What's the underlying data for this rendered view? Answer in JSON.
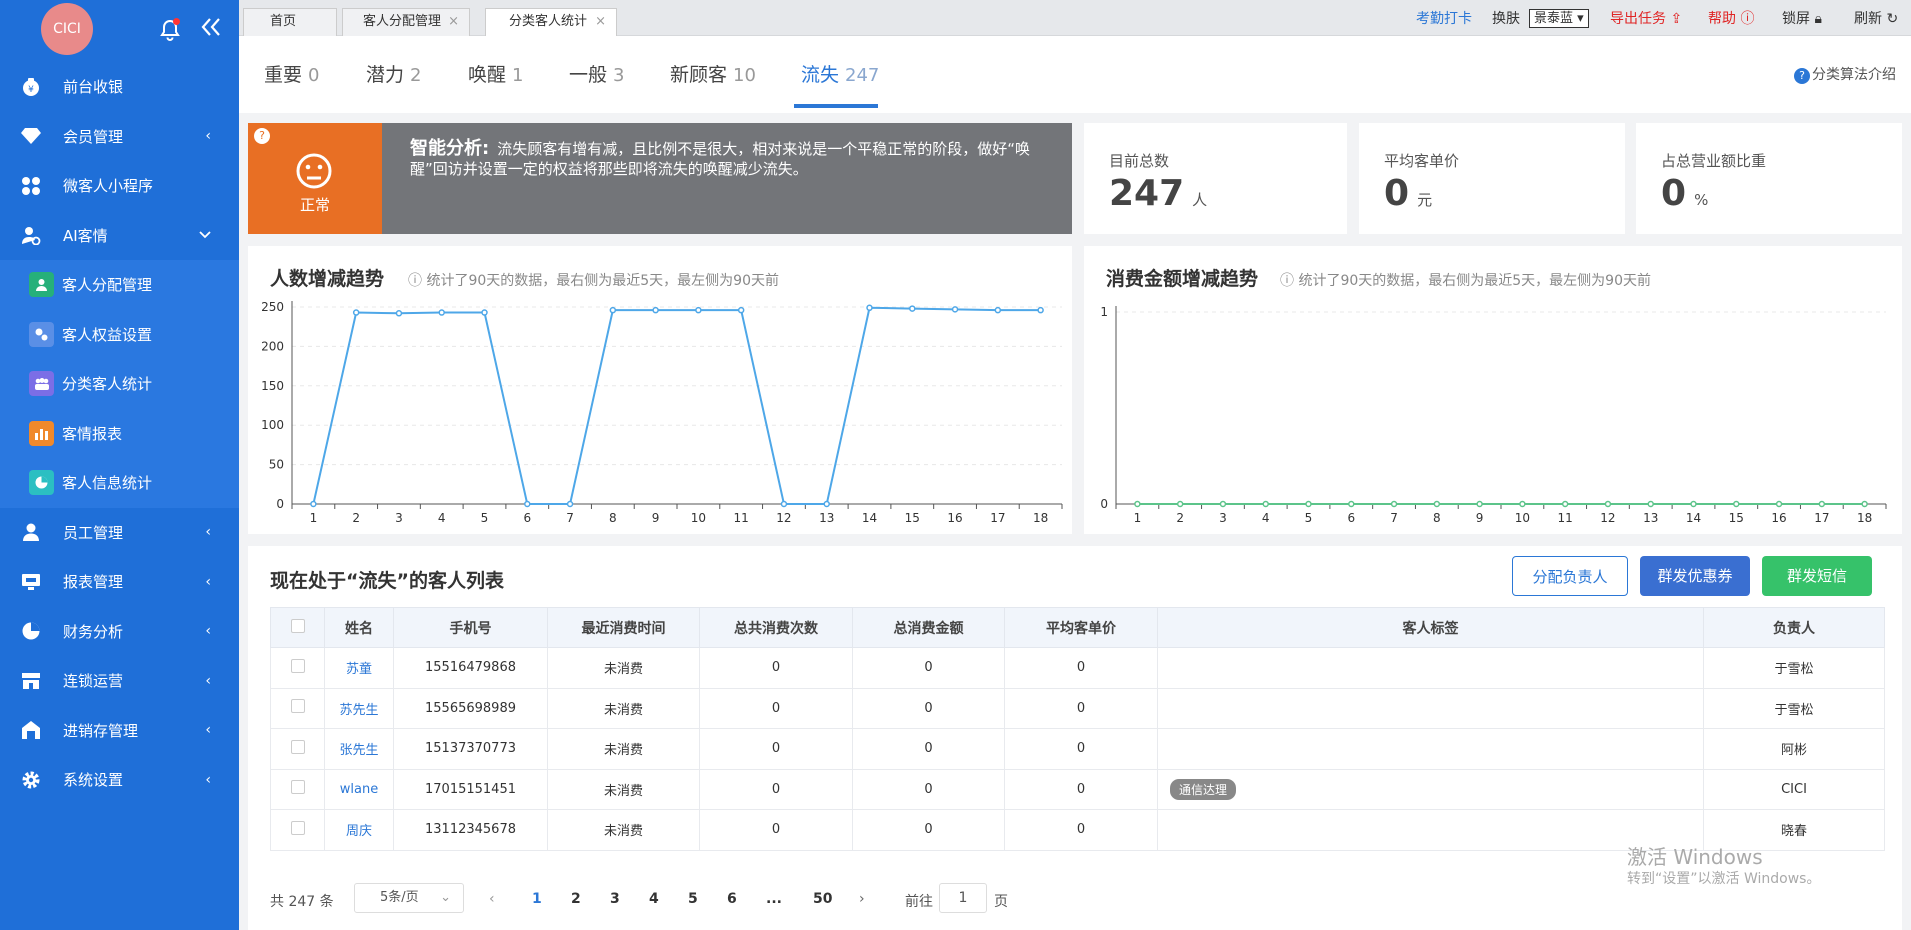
{
  "sidebar": {
    "avatar": "CICI",
    "menu": [
      {
        "label": "前台收银",
        "arrow": ""
      },
      {
        "label": "会员管理",
        "arrow": "‹"
      },
      {
        "label": "微客人小程序",
        "arrow": ""
      },
      {
        "label": "AI客情",
        "arrow": "⌄"
      }
    ],
    "sub": [
      {
        "label": "客人分配管理"
      },
      {
        "label": "客人权益设置"
      },
      {
        "label": "分类客人统计"
      },
      {
        "label": "客情报表"
      },
      {
        "label": "客人信息统计"
      }
    ],
    "menu2": [
      {
        "label": "员工管理",
        "arrow": "‹"
      },
      {
        "label": "报表管理",
        "arrow": "‹"
      },
      {
        "label": "财务分析",
        "arrow": "‹"
      },
      {
        "label": "连锁运营",
        "arrow": "‹"
      },
      {
        "label": "进销存管理",
        "arrow": "‹"
      },
      {
        "label": "系统设置",
        "arrow": "‹"
      }
    ]
  },
  "topbar": {
    "tabs": [
      "首页",
      "客人分配管理",
      "分类客人统计"
    ],
    "close": "×",
    "attendance": "考勤打卡",
    "skin_label": "换肤",
    "skin_value": "景泰蓝",
    "export": "导出任务",
    "help": "帮助",
    "lock": "锁屏",
    "refresh": "刷新"
  },
  "subtabs": [
    {
      "label": "重要",
      "count": "0"
    },
    {
      "label": "潜力",
      "count": "2"
    },
    {
      "label": "唤醒",
      "count": "1"
    },
    {
      "label": "一般",
      "count": "3"
    },
    {
      "label": "新顾客",
      "count": "10"
    },
    {
      "label": "流失",
      "count": "247"
    }
  ],
  "algo_link": "分类算法介绍",
  "analysis": {
    "status": "正常",
    "title": "智能分析:",
    "text": "流失顾客有增有减，且比例不是很大，相对来说是一个平稳正常的阶段，做好“唤醒”回访并设置一定的权益将那些即将流失的唤醒减少流失。"
  },
  "stats": [
    {
      "label": "目前总数",
      "value": "247",
      "unit": "人"
    },
    {
      "label": "平均客单价",
      "value": "0",
      "unit": "元"
    },
    {
      "label": "占总营业额比重",
      "value": "0",
      "unit": "%"
    }
  ],
  "chart_data": [
    {
      "type": "line",
      "title": "人数增减趋势",
      "note": "统计了90天的数据，最右侧为最近5天，最左侧为90天前",
      "x": [
        1,
        2,
        3,
        4,
        5,
        6,
        7,
        8,
        9,
        10,
        11,
        12,
        13,
        14,
        15,
        16,
        17,
        18
      ],
      "series": [
        {
          "values": [
            0,
            243,
            242,
            243,
            243,
            0,
            0,
            246,
            246,
            246,
            246,
            0,
            0,
            249,
            248,
            247,
            246,
            246
          ]
        }
      ],
      "ylim": [
        0,
        250
      ],
      "yticks": [
        0,
        50,
        100,
        150,
        200,
        250
      ],
      "color": "#4ea7e8",
      "grid": true
    },
    {
      "type": "line",
      "title": "消费金额增减趋势",
      "note": "统计了90天的数据，最右侧为最近5天，最左侧为90天前",
      "x": [
        1,
        2,
        3,
        4,
        5,
        6,
        7,
        8,
        9,
        10,
        11,
        12,
        13,
        14,
        15,
        16,
        17,
        18
      ],
      "series": [
        {
          "values": [
            0,
            0,
            0,
            0,
            0,
            0,
            0,
            0,
            0,
            0,
            0,
            0,
            0,
            0,
            0,
            0,
            0,
            0
          ]
        }
      ],
      "ylim": [
        0,
        1
      ],
      "yticks": [
        0,
        1
      ],
      "color": "#5cc48a",
      "grid": true
    }
  ],
  "list": {
    "title": "现在处于“流失”的客人列表",
    "buttons": [
      "分配负责人",
      "群发优惠券",
      "群发短信"
    ],
    "columns": [
      "姓名",
      "手机号",
      "最近消费时间",
      "总共消费次数",
      "总消费金额",
      "平均客单价",
      "客人标签",
      "负责人"
    ],
    "rows": [
      {
        "name": "苏童",
        "phone": "15516479868",
        "last": "未消费",
        "times": "0",
        "total": "0",
        "avg": "0",
        "tag": "",
        "owner": "于雪松"
      },
      {
        "name": "苏先生",
        "phone": "15565698989",
        "last": "未消费",
        "times": "0",
        "total": "0",
        "avg": "0",
        "tag": "",
        "owner": "于雪松"
      },
      {
        "name": "张先生",
        "phone": "15137370773",
        "last": "未消费",
        "times": "0",
        "total": "0",
        "avg": "0",
        "tag": "",
        "owner": "阿彬"
      },
      {
        "name": "wlane",
        "phone": "17015151451",
        "last": "未消费",
        "times": "0",
        "total": "0",
        "avg": "0",
        "tag": "通信达理",
        "owner": "CICI"
      },
      {
        "name": "周庆",
        "phone": "13112345678",
        "last": "未消费",
        "times": "0",
        "total": "0",
        "avg": "0",
        "tag": "",
        "owner": "晓春"
      }
    ],
    "pager": {
      "total": "共 247 条",
      "page_size": "5条/页",
      "pages": [
        "1",
        "2",
        "3",
        "4",
        "5",
        "6",
        "...",
        "50"
      ],
      "goto_prefix": "前往",
      "goto_value": "1",
      "goto_suffix": "页"
    }
  },
  "watermark": {
    "line1": "激活 Windows",
    "line2": "转到“设置”以激活 Windows。"
  }
}
